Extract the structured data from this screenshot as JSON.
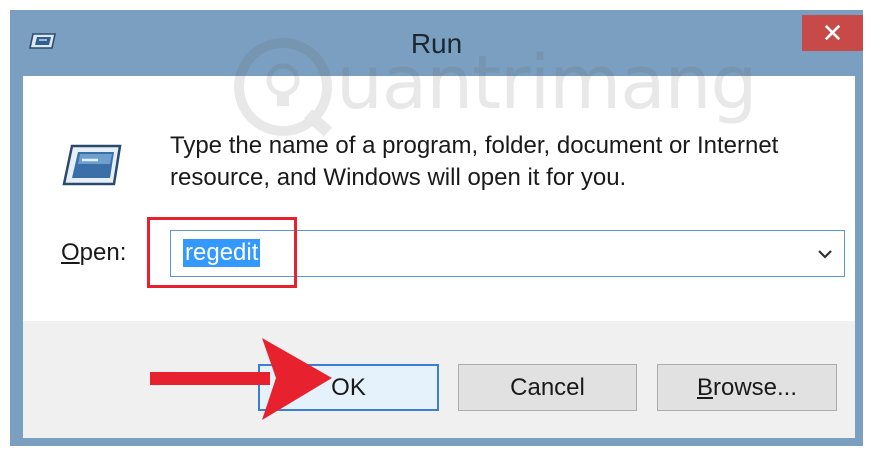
{
  "window": {
    "title": "Run",
    "close_glyph": "✕"
  },
  "watermark": {
    "text": "uantrimang"
  },
  "dialog": {
    "description": "Type the name of a program, folder, document or Internet resource, and Windows will open it for you.",
    "open_label_accel": "O",
    "open_label_rest": "pen:",
    "open_value": "regedit"
  },
  "buttons": {
    "ok": "OK",
    "cancel": "Cancel",
    "browse_accel": "B",
    "browse_rest": "rowse..."
  },
  "icons": {
    "title": "run-app-icon",
    "dialog": "run-app-icon",
    "dropdown": "chevron-down-icon",
    "annotation": "red-arrow-icon"
  },
  "colors": {
    "titlebar": "#7a9fc0",
    "close_button": "#c74a49",
    "selection": "#3399ff",
    "annotation_red": "#e8212f",
    "focus_border": "#3c7fd1"
  }
}
